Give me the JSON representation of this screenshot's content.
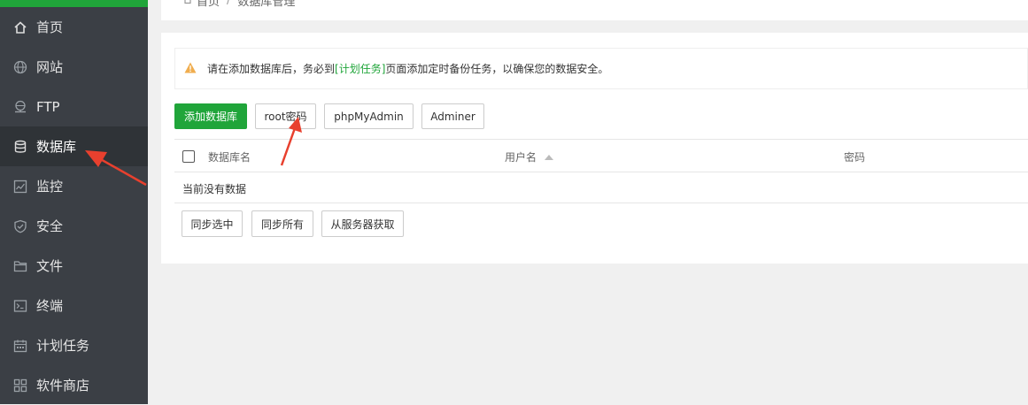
{
  "sidebar": {
    "accent_color": "#20a53a",
    "items": [
      {
        "label": "首页",
        "icon": "home-icon"
      },
      {
        "label": "网站",
        "icon": "globe-icon"
      },
      {
        "label": "FTP",
        "icon": "ftp-icon"
      },
      {
        "label": "数据库",
        "icon": "database-icon",
        "active": true
      },
      {
        "label": "监控",
        "icon": "monitor-icon"
      },
      {
        "label": "安全",
        "icon": "shield-icon"
      },
      {
        "label": "文件",
        "icon": "folder-icon"
      },
      {
        "label": "终端",
        "icon": "terminal-icon"
      },
      {
        "label": "计划任务",
        "icon": "calendar-icon"
      },
      {
        "label": "软件商店",
        "icon": "apps-icon"
      }
    ]
  },
  "breadcrumb": {
    "home": "首页",
    "separator": "/",
    "current": "数据库管理"
  },
  "alert": {
    "text_before": "请在添加数据库后，务必到",
    "link": "[计划任务]",
    "text_after": "页面添加定时备份任务，以确保您的数据安全。"
  },
  "toolbar": {
    "add_db": "添加数据库",
    "root_pwd": "root密码",
    "phpmyadmin": "phpMyAdmin",
    "adminer": "Adminer"
  },
  "table": {
    "headers": {
      "db_name": "数据库名",
      "username": "用户名",
      "password": "密码"
    },
    "empty": "当前没有数据"
  },
  "sync": {
    "selected": "同步选中",
    "all": "同步所有",
    "from_server": "从服务器获取"
  }
}
